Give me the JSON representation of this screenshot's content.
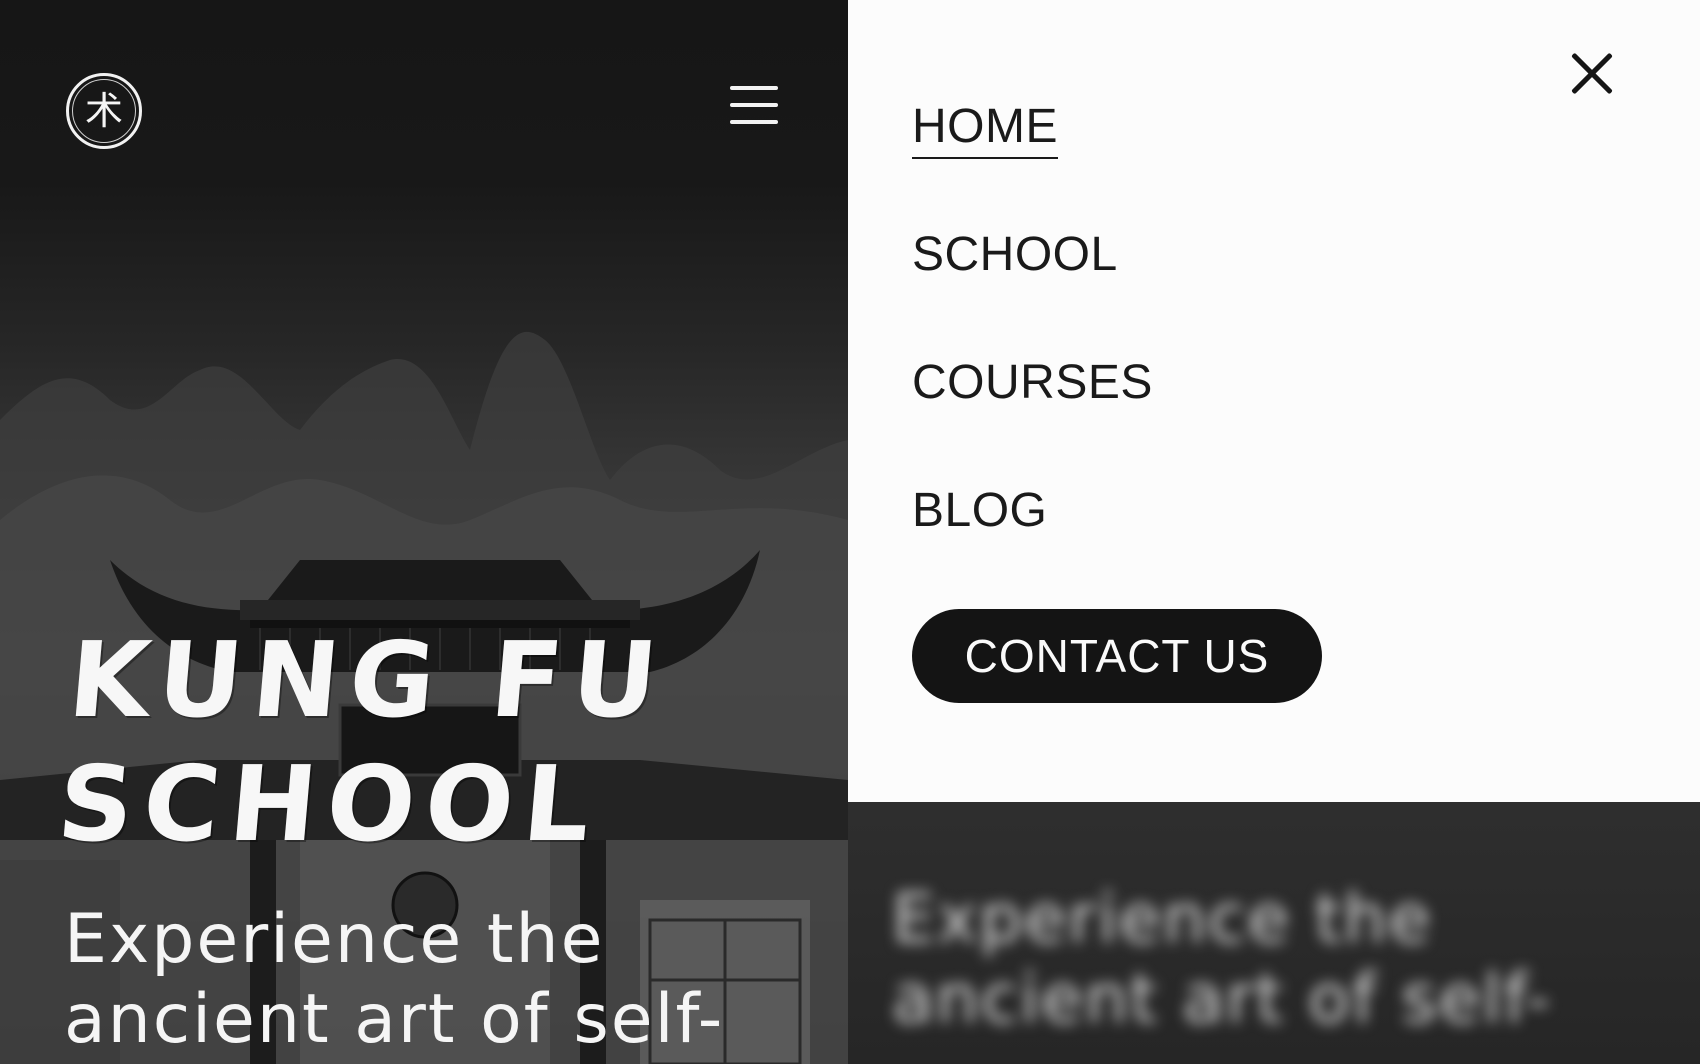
{
  "hero": {
    "logo_glyph": "术",
    "title_line1": "KUNG FU",
    "title_line2": "SCHOOL",
    "subtitle_line1": "Experience the",
    "subtitle_line2": "ancient art of self-"
  },
  "menu": {
    "items": [
      {
        "label": "HOME",
        "active": true
      },
      {
        "label": "SCHOOL",
        "active": false
      },
      {
        "label": "COURSES",
        "active": false
      },
      {
        "label": "BLOG",
        "active": false
      }
    ],
    "contact_label": "CONTACT US"
  },
  "icons": {
    "logo": "kung-fu-logo-icon",
    "open_menu": "hamburger-menu-icon",
    "close_menu": "close-icon"
  },
  "colors": {
    "menu_background": "#fcfcfc",
    "text_dark": "#1a1a1a",
    "button_background": "#141414",
    "hero_text": "#f7f7f7"
  }
}
